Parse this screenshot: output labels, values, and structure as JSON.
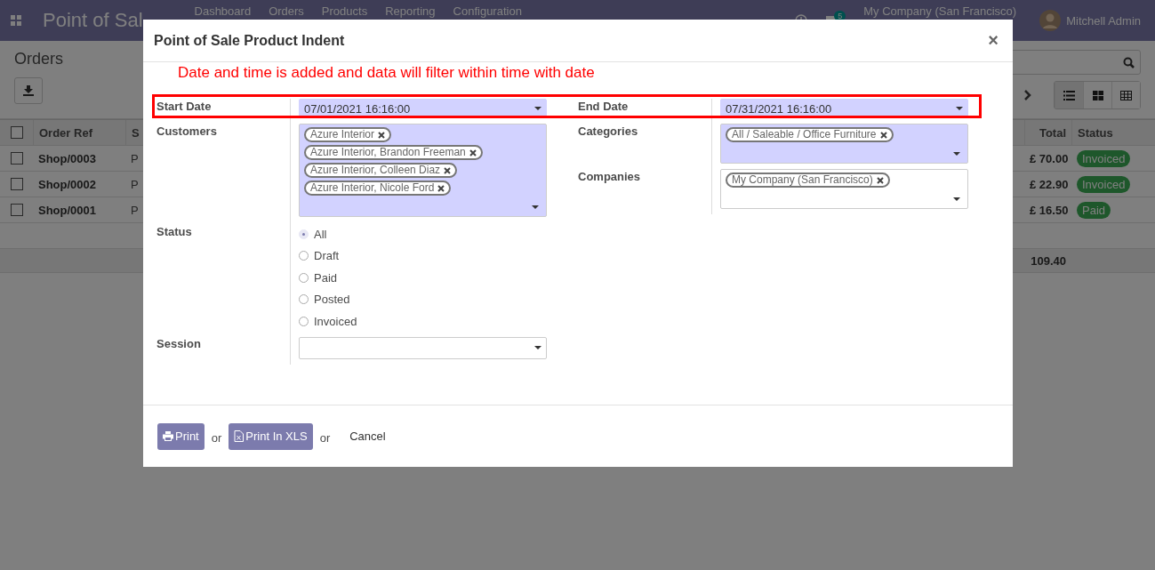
{
  "navbar": {
    "app_title": "Point of Sal",
    "menu": [
      "Dashboard",
      "Orders",
      "Products",
      "Reporting",
      "Configuration"
    ],
    "message_count": "5",
    "company": "My Company (San Francisco)",
    "user": "Mitchell Admin"
  },
  "control_panel": {
    "title": "Orders",
    "views": [
      {
        "kind": "list",
        "selected": true
      },
      {
        "kind": "kanban",
        "selected": false
      },
      {
        "kind": "pivot",
        "selected": false
      }
    ]
  },
  "table": {
    "columns": [
      "Order Ref",
      "S",
      "Total",
      "Status"
    ],
    "rows": [
      {
        "checked": false,
        "ref": "Shop/0003",
        "column_3": "P",
        "total": "£ 70.00",
        "status": "Invoiced"
      },
      {
        "checked": false,
        "ref": "Shop/0002",
        "column_3": "P",
        "total": "£ 22.90",
        "status": "Invoiced"
      },
      {
        "checked": false,
        "ref": "Shop/0001",
        "column_3": "P",
        "total": "£ 16.50",
        "status": "Paid"
      }
    ],
    "footer_total": "109.40",
    "all_checked": false
  },
  "dialog": {
    "title": "Point of Sale Product Indent",
    "close": "×",
    "note": "Date and time is added and data will filter within time  with date",
    "start_date": {
      "label": "Start Date",
      "value": "07/01/2021 16:16:00",
      "required": true
    },
    "end_date": {
      "label": "End Date",
      "value": "07/31/2021 16:16:00",
      "required": true
    },
    "customers": {
      "label": "Customers",
      "required": true,
      "tags": [
        "Azure Interior",
        "Azure Interior, Brandon Freeman",
        "Azure Interior, Colleen Diaz",
        "Azure Interior, Nicole Ford"
      ]
    },
    "categories": {
      "label": "Categories",
      "required": true,
      "tags": [
        "All / Saleable / Office Furniture"
      ]
    },
    "companies": {
      "label": "Companies",
      "required": false,
      "tags": [
        "My Company (San Francisco)"
      ]
    },
    "status": {
      "label": "Status",
      "options": [
        {
          "label": "All",
          "selected": true
        },
        {
          "label": "Draft",
          "selected": false
        },
        {
          "label": "Paid",
          "selected": false
        },
        {
          "label": "Posted",
          "selected": false
        },
        {
          "label": "Invoiced",
          "selected": false
        }
      ]
    },
    "session": {
      "label": "Session",
      "required": false
    },
    "buttons": {
      "print": "Print",
      "print_xls": "Print In XLS",
      "separators": [
        "or",
        "or"
      ],
      "cancel": "Cancel"
    }
  }
}
